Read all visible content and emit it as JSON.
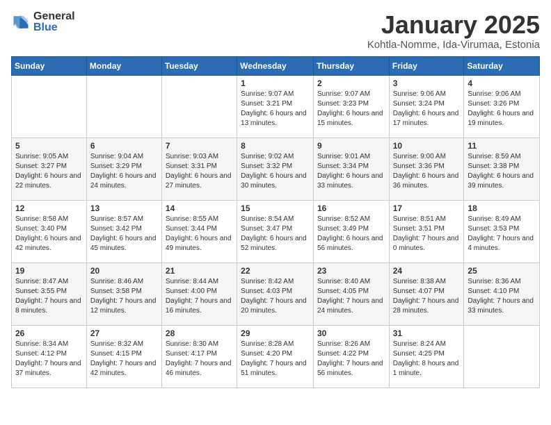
{
  "logo": {
    "text_general": "General",
    "text_blue": "Blue"
  },
  "title": "January 2025",
  "subtitle": "Kohtla-Nomme, Ida-Virumaa, Estonia",
  "days_of_week": [
    "Sunday",
    "Monday",
    "Tuesday",
    "Wednesday",
    "Thursday",
    "Friday",
    "Saturday"
  ],
  "weeks": [
    [
      {
        "day": "",
        "info": ""
      },
      {
        "day": "",
        "info": ""
      },
      {
        "day": "",
        "info": ""
      },
      {
        "day": "1",
        "info": "Sunrise: 9:07 AM\nSunset: 3:21 PM\nDaylight: 6 hours\nand 13 minutes."
      },
      {
        "day": "2",
        "info": "Sunrise: 9:07 AM\nSunset: 3:23 PM\nDaylight: 6 hours\nand 15 minutes."
      },
      {
        "day": "3",
        "info": "Sunrise: 9:06 AM\nSunset: 3:24 PM\nDaylight: 6 hours\nand 17 minutes."
      },
      {
        "day": "4",
        "info": "Sunrise: 9:06 AM\nSunset: 3:26 PM\nDaylight: 6 hours\nand 19 minutes."
      }
    ],
    [
      {
        "day": "5",
        "info": "Sunrise: 9:05 AM\nSunset: 3:27 PM\nDaylight: 6 hours\nand 22 minutes."
      },
      {
        "day": "6",
        "info": "Sunrise: 9:04 AM\nSunset: 3:29 PM\nDaylight: 6 hours\nand 24 minutes."
      },
      {
        "day": "7",
        "info": "Sunrise: 9:03 AM\nSunset: 3:31 PM\nDaylight: 6 hours\nand 27 minutes."
      },
      {
        "day": "8",
        "info": "Sunrise: 9:02 AM\nSunset: 3:32 PM\nDaylight: 6 hours\nand 30 minutes."
      },
      {
        "day": "9",
        "info": "Sunrise: 9:01 AM\nSunset: 3:34 PM\nDaylight: 6 hours\nand 33 minutes."
      },
      {
        "day": "10",
        "info": "Sunrise: 9:00 AM\nSunset: 3:36 PM\nDaylight: 6 hours\nand 36 minutes."
      },
      {
        "day": "11",
        "info": "Sunrise: 8:59 AM\nSunset: 3:38 PM\nDaylight: 6 hours\nand 39 minutes."
      }
    ],
    [
      {
        "day": "12",
        "info": "Sunrise: 8:58 AM\nSunset: 3:40 PM\nDaylight: 6 hours\nand 42 minutes."
      },
      {
        "day": "13",
        "info": "Sunrise: 8:57 AM\nSunset: 3:42 PM\nDaylight: 6 hours\nand 45 minutes."
      },
      {
        "day": "14",
        "info": "Sunrise: 8:55 AM\nSunset: 3:44 PM\nDaylight: 6 hours\nand 49 minutes."
      },
      {
        "day": "15",
        "info": "Sunrise: 8:54 AM\nSunset: 3:47 PM\nDaylight: 6 hours\nand 52 minutes."
      },
      {
        "day": "16",
        "info": "Sunrise: 8:52 AM\nSunset: 3:49 PM\nDaylight: 6 hours\nand 56 minutes."
      },
      {
        "day": "17",
        "info": "Sunrise: 8:51 AM\nSunset: 3:51 PM\nDaylight: 7 hours\nand 0 minutes."
      },
      {
        "day": "18",
        "info": "Sunrise: 8:49 AM\nSunset: 3:53 PM\nDaylight: 7 hours\nand 4 minutes."
      }
    ],
    [
      {
        "day": "19",
        "info": "Sunrise: 8:47 AM\nSunset: 3:55 PM\nDaylight: 7 hours\nand 8 minutes."
      },
      {
        "day": "20",
        "info": "Sunrise: 8:46 AM\nSunset: 3:58 PM\nDaylight: 7 hours\nand 12 minutes."
      },
      {
        "day": "21",
        "info": "Sunrise: 8:44 AM\nSunset: 4:00 PM\nDaylight: 7 hours\nand 16 minutes."
      },
      {
        "day": "22",
        "info": "Sunrise: 8:42 AM\nSunset: 4:03 PM\nDaylight: 7 hours\nand 20 minutes."
      },
      {
        "day": "23",
        "info": "Sunrise: 8:40 AM\nSunset: 4:05 PM\nDaylight: 7 hours\nand 24 minutes."
      },
      {
        "day": "24",
        "info": "Sunrise: 8:38 AM\nSunset: 4:07 PM\nDaylight: 7 hours\nand 28 minutes."
      },
      {
        "day": "25",
        "info": "Sunrise: 8:36 AM\nSunset: 4:10 PM\nDaylight: 7 hours\nand 33 minutes."
      }
    ],
    [
      {
        "day": "26",
        "info": "Sunrise: 8:34 AM\nSunset: 4:12 PM\nDaylight: 7 hours\nand 37 minutes."
      },
      {
        "day": "27",
        "info": "Sunrise: 8:32 AM\nSunset: 4:15 PM\nDaylight: 7 hours\nand 42 minutes."
      },
      {
        "day": "28",
        "info": "Sunrise: 8:30 AM\nSunset: 4:17 PM\nDaylight: 7 hours\nand 46 minutes."
      },
      {
        "day": "29",
        "info": "Sunrise: 8:28 AM\nSunset: 4:20 PM\nDaylight: 7 hours\nand 51 minutes."
      },
      {
        "day": "30",
        "info": "Sunrise: 8:26 AM\nSunset: 4:22 PM\nDaylight: 7 hours\nand 56 minutes."
      },
      {
        "day": "31",
        "info": "Sunrise: 8:24 AM\nSunset: 4:25 PM\nDaylight: 8 hours\nand 1 minute."
      },
      {
        "day": "",
        "info": ""
      }
    ]
  ]
}
